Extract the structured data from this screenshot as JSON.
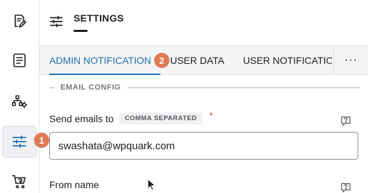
{
  "header": {
    "title": "SETTINGS",
    "icon": "sliders-icon"
  },
  "sidebar": {
    "items": [
      {
        "icon": "edit-document-icon",
        "active": false
      },
      {
        "icon": "form-list-icon",
        "active": false
      },
      {
        "icon": "workflow-gear-icon",
        "active": false
      },
      {
        "icon": "sliders-icon",
        "active": true
      },
      {
        "icon": "cart-refund-icon",
        "active": false
      }
    ]
  },
  "badges": {
    "first": "1",
    "second": "2"
  },
  "tabs": [
    {
      "label": "ADMIN NOTIFICATION",
      "active": true
    },
    {
      "label": "USER DATA",
      "active": false
    },
    {
      "label": "USER NOTIFICATION",
      "active": false
    }
  ],
  "tabs_more": "···",
  "section": {
    "title": "EMAIL CONFIG"
  },
  "fields": {
    "send_to": {
      "label": "Send emails to",
      "chip": "COMMA SEPARATED",
      "required_mark": "*",
      "value": "swashata@wpquark.com"
    },
    "from_name": {
      "label": "From name"
    }
  },
  "colors": {
    "accent": "#2271b1",
    "badge": "#e07a55",
    "required": "#d63638"
  }
}
